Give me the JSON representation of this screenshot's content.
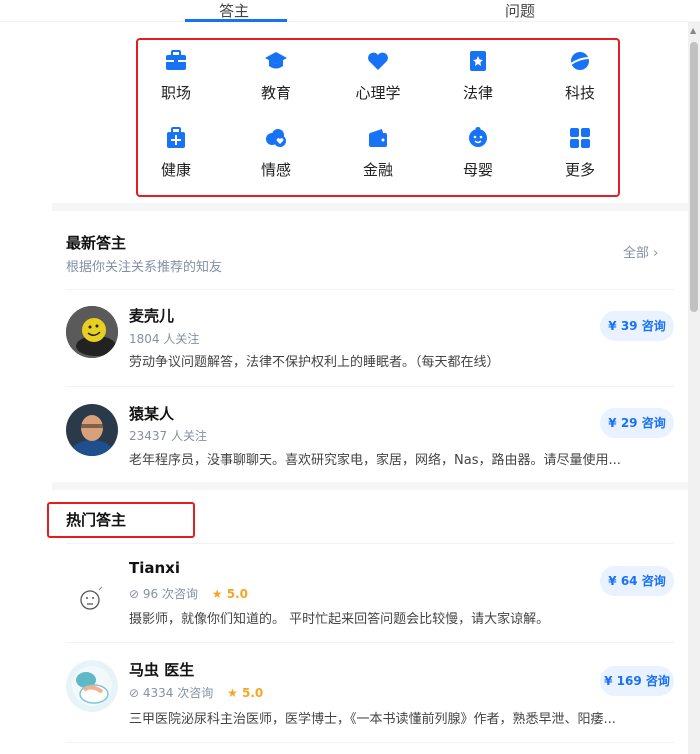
{
  "tabs": {
    "answerer": "答主",
    "question": "问题"
  },
  "categories": [
    {
      "label": "职场",
      "icon": "briefcase-icon"
    },
    {
      "label": "教育",
      "icon": "graduation-cap-icon"
    },
    {
      "label": "心理学",
      "icon": "heart-icon"
    },
    {
      "label": "法律",
      "icon": "law-book-icon"
    },
    {
      "label": "科技",
      "icon": "planet-icon"
    },
    {
      "label": "健康",
      "icon": "medical-kit-icon"
    },
    {
      "label": "情感",
      "icon": "heart-cloud-icon"
    },
    {
      "label": "金融",
      "icon": "wallet-icon"
    },
    {
      "label": "母婴",
      "icon": "baby-icon"
    },
    {
      "label": "更多",
      "icon": "grid-more-icon"
    }
  ],
  "latest": {
    "title": "最新答主",
    "subtitle": "根据你关注关系推荐的知友",
    "all_link": "全部 ›",
    "items": [
      {
        "name": "麦壳儿",
        "meta": "1804 人关注",
        "desc": "劳动争议问题解答，法律不保护权利上的睡眠者。（每天都在线）",
        "price": "¥ 39 咨询"
      },
      {
        "name": "猿某人",
        "meta": "23437 人关注",
        "desc": "老年程序员，没事聊聊天。喜欢研究家电，家居，网络，Nas，路由器。请尽量使用...",
        "price": "¥ 29 咨询"
      }
    ]
  },
  "hot": {
    "title": "热门答主",
    "items": [
      {
        "name": "Tianxi",
        "meta": "⊘ 96 次咨询",
        "rating": "★ 5.0",
        "desc": "摄影师，就像你们知道的。 平时忙起来回答问题会比较慢，请大家谅解。",
        "price": "¥ 64 咨询"
      },
      {
        "name": "马虫 医生",
        "meta": "⊘ 4334 次咨询",
        "rating": "★ 5.0",
        "desc": "三甲医院泌尿科主治医师，医学博士，《一本书读懂前列腺》作者，熟悉早泄、阳痿...",
        "price": "¥ 169 咨询"
      }
    ]
  },
  "colors": {
    "accent": "#1772f6",
    "highlight_box": "#e02020",
    "star": "#f5a623"
  }
}
